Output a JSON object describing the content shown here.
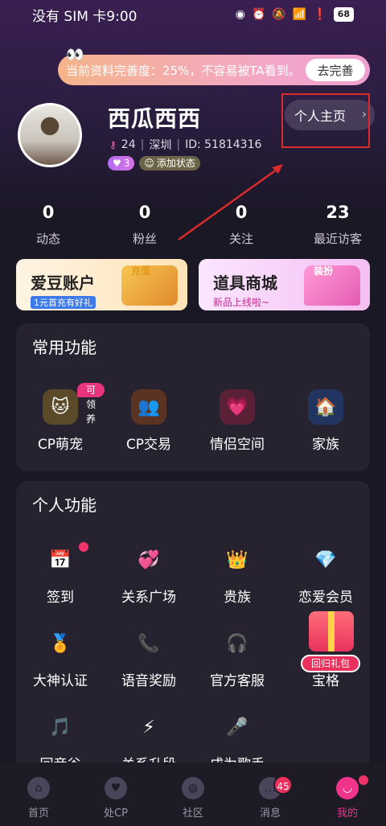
{
  "status_bar": {
    "carrier_time": "没有 SIM 卡9:00",
    "battery": "68"
  },
  "banner": {
    "text": "当前资料完善度：25%，不容易被TA看到。",
    "button": "去完善"
  },
  "profile": {
    "name": "西瓜西西",
    "level_num": "24",
    "city": "深圳",
    "id_text": "ID:  51814316",
    "badge_count": "3",
    "add_status": "添加状态",
    "home_button": "个人主页"
  },
  "stats": [
    {
      "value": "0",
      "label": "动态"
    },
    {
      "value": "0",
      "label": "粉丝"
    },
    {
      "value": "0",
      "label": "关注"
    },
    {
      "value": "23",
      "label": "最近访客"
    }
  ],
  "promos": {
    "idol": {
      "title": "爱豆账户",
      "sub": "1元首充有好礼",
      "deco": "充值"
    },
    "shop": {
      "title": "道具商城",
      "sub": "新品上线啦~",
      "deco": "装扮"
    }
  },
  "common": {
    "title": "常用功能",
    "claim_badge": "可领养",
    "items": [
      {
        "label": "CP萌宠",
        "icon": "pet-icon"
      },
      {
        "label": "CP交易",
        "icon": "cp-trade-icon"
      },
      {
        "label": "情侣空间",
        "icon": "couple-space-icon"
      },
      {
        "label": "家族",
        "icon": "family-icon"
      }
    ]
  },
  "personal": {
    "title": "个人功能",
    "rows": [
      [
        {
          "label": "签到",
          "icon": "calendar-icon"
        },
        {
          "label": "关系广场",
          "icon": "hearts-icon"
        },
        {
          "label": "贵族",
          "icon": "crown-icon"
        },
        {
          "label": "恋爱会员",
          "icon": "diamond-icon"
        }
      ],
      [
        {
          "label": "大神认证",
          "icon": "medal-icon"
        },
        {
          "label": "语音奖励",
          "icon": "phone-icon"
        },
        {
          "label": "官方客服",
          "icon": "headset-icon"
        },
        {
          "label": "宝格",
          "icon": "gift-icon"
        }
      ],
      [
        {
          "label": "回音谷",
          "icon": "music-icon"
        },
        {
          "label": "关系升段",
          "icon": "lightning-icon"
        },
        {
          "label": "成为歌手",
          "icon": "microphone-icon"
        }
      ]
    ],
    "gift_label": "回归礼包"
  },
  "tabbar": [
    {
      "label": "首页",
      "icon": "home-icon"
    },
    {
      "label": "处CP",
      "icon": "heart-icon"
    },
    {
      "label": "社区",
      "icon": "planet-icon"
    },
    {
      "label": "消息",
      "icon": "message-icon",
      "badge": "45"
    },
    {
      "label": "我的",
      "icon": "smile-icon"
    }
  ]
}
